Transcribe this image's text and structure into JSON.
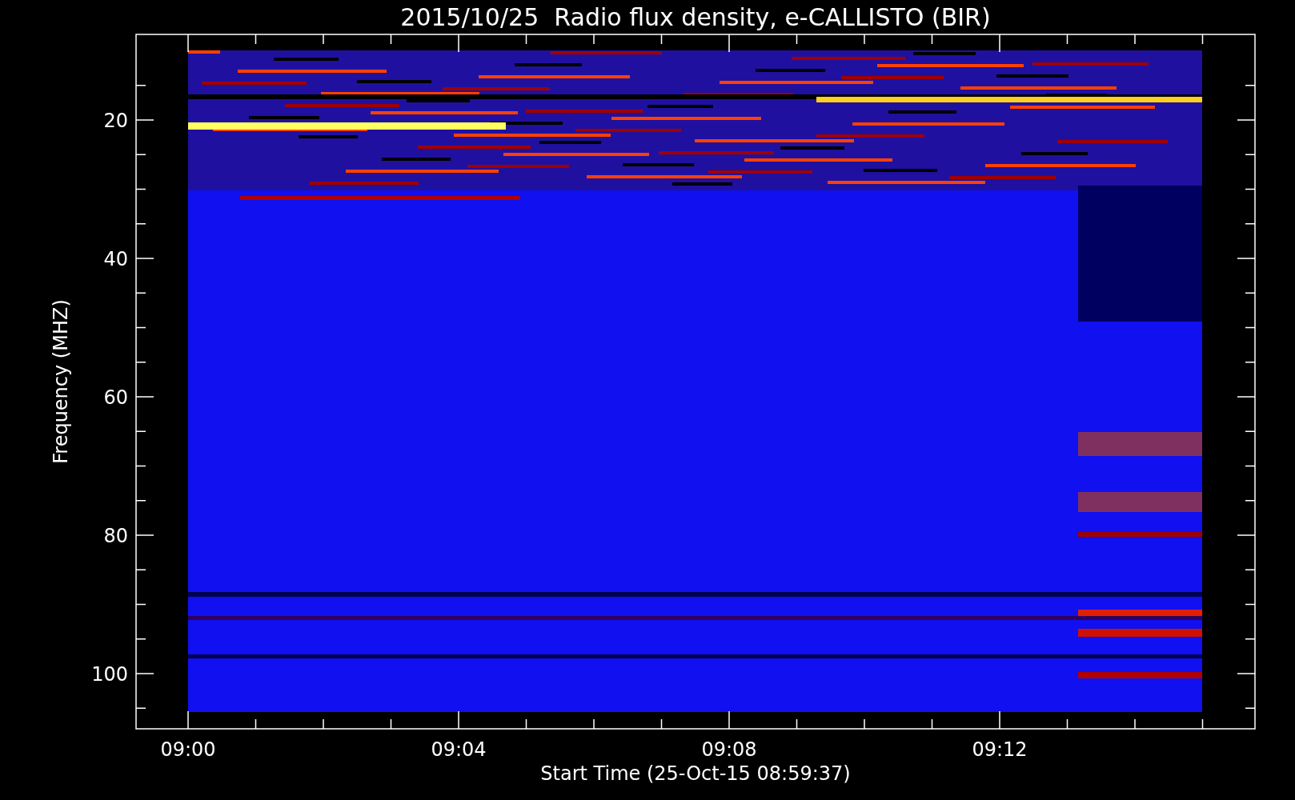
{
  "title": "2015/10/25  Radio flux density, e-CALLISTO (BIR)",
  "ylabel": "Frequency (MHZ)",
  "xlabel": "Start Time (25-Oct-15 08:59:37)",
  "ytick_labels": [
    "20",
    "40",
    "60",
    "80",
    "100"
  ],
  "xtick_labels": [
    "09:00",
    "09:04",
    "09:08",
    "09:12"
  ]
}
